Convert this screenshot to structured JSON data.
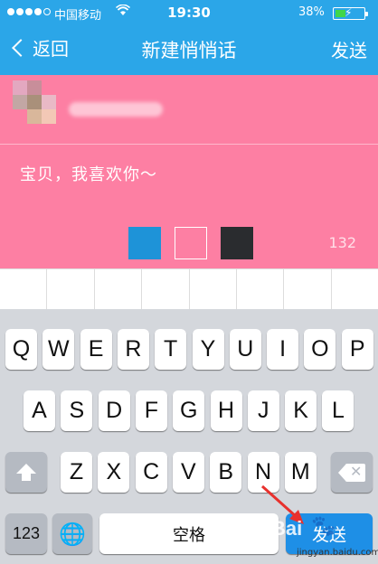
{
  "status_bar": {
    "carrier": "中国移动",
    "time": "19:30",
    "battery_percent": "38%",
    "battery_level": 0.38,
    "signal_bars_filled": 4,
    "signal_bars_total": 5
  },
  "nav": {
    "back_label": "返回",
    "title": "新建悄悄话",
    "send_label": "发送"
  },
  "card": {
    "message": "宝贝，我喜欢你～",
    "char_counter": "132",
    "background_color": "#fd7fa3",
    "color_options": [
      "#1e93d8",
      "#fd7fa3",
      "#2a2c2f"
    ]
  },
  "keyboard": {
    "row1": [
      "Q",
      "W",
      "E",
      "R",
      "T",
      "Y",
      "U",
      "I",
      "O",
      "P"
    ],
    "row2": [
      "A",
      "S",
      "D",
      "F",
      "G",
      "H",
      "J",
      "K",
      "L"
    ],
    "row3": [
      "Z",
      "X",
      "C",
      "V",
      "B",
      "N",
      "M"
    ],
    "numbers_label": "123",
    "space_label": "空格",
    "send_label": "发送"
  },
  "watermark": {
    "text": "Bai",
    "url": "jingyan.baidu.com"
  },
  "colors": {
    "nav_blue": "#2ba6e8",
    "keyboard_bg": "#d4d7dc",
    "send_key_blue": "#1e8fe6",
    "pointer_red": "#e8312d"
  }
}
